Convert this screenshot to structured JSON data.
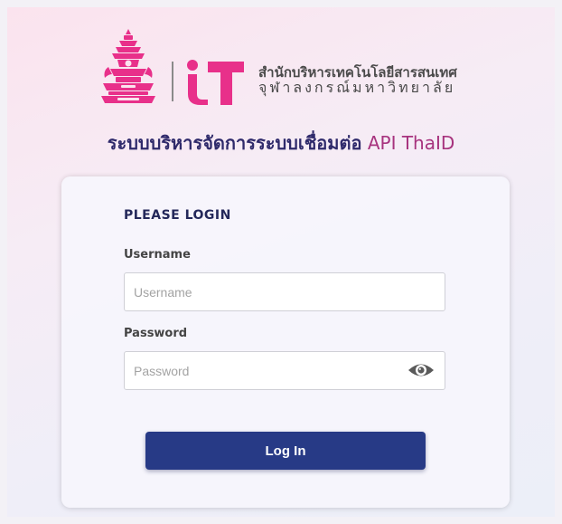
{
  "header": {
    "org_name_line1": "สำนักบริหารเทคโนโลยีสารสนเทศ",
    "org_name_line2": "จุฬาลงกรณ์มหาวิทยาลัย",
    "system_title_thai": "ระบบบริหารจัดการระบบเชื่อมต่อ",
    "system_title_api": "API ThaID"
  },
  "login": {
    "title": "PLEASE LOGIN",
    "username_label": "Username",
    "username_placeholder": "Username",
    "username_value": "",
    "password_label": "Password",
    "password_placeholder": "Password",
    "password_value": "",
    "submit_label": "Log In"
  },
  "icons": {
    "seal": "chulalongkorn-seal-icon",
    "brand": "it-logo-icon",
    "password_toggle": "eye-icon"
  },
  "colors": {
    "primary_button": "#273a86",
    "title_thai": "#2f2a6b",
    "title_api": "#a7337e",
    "brand_pink": "#e8308a"
  }
}
